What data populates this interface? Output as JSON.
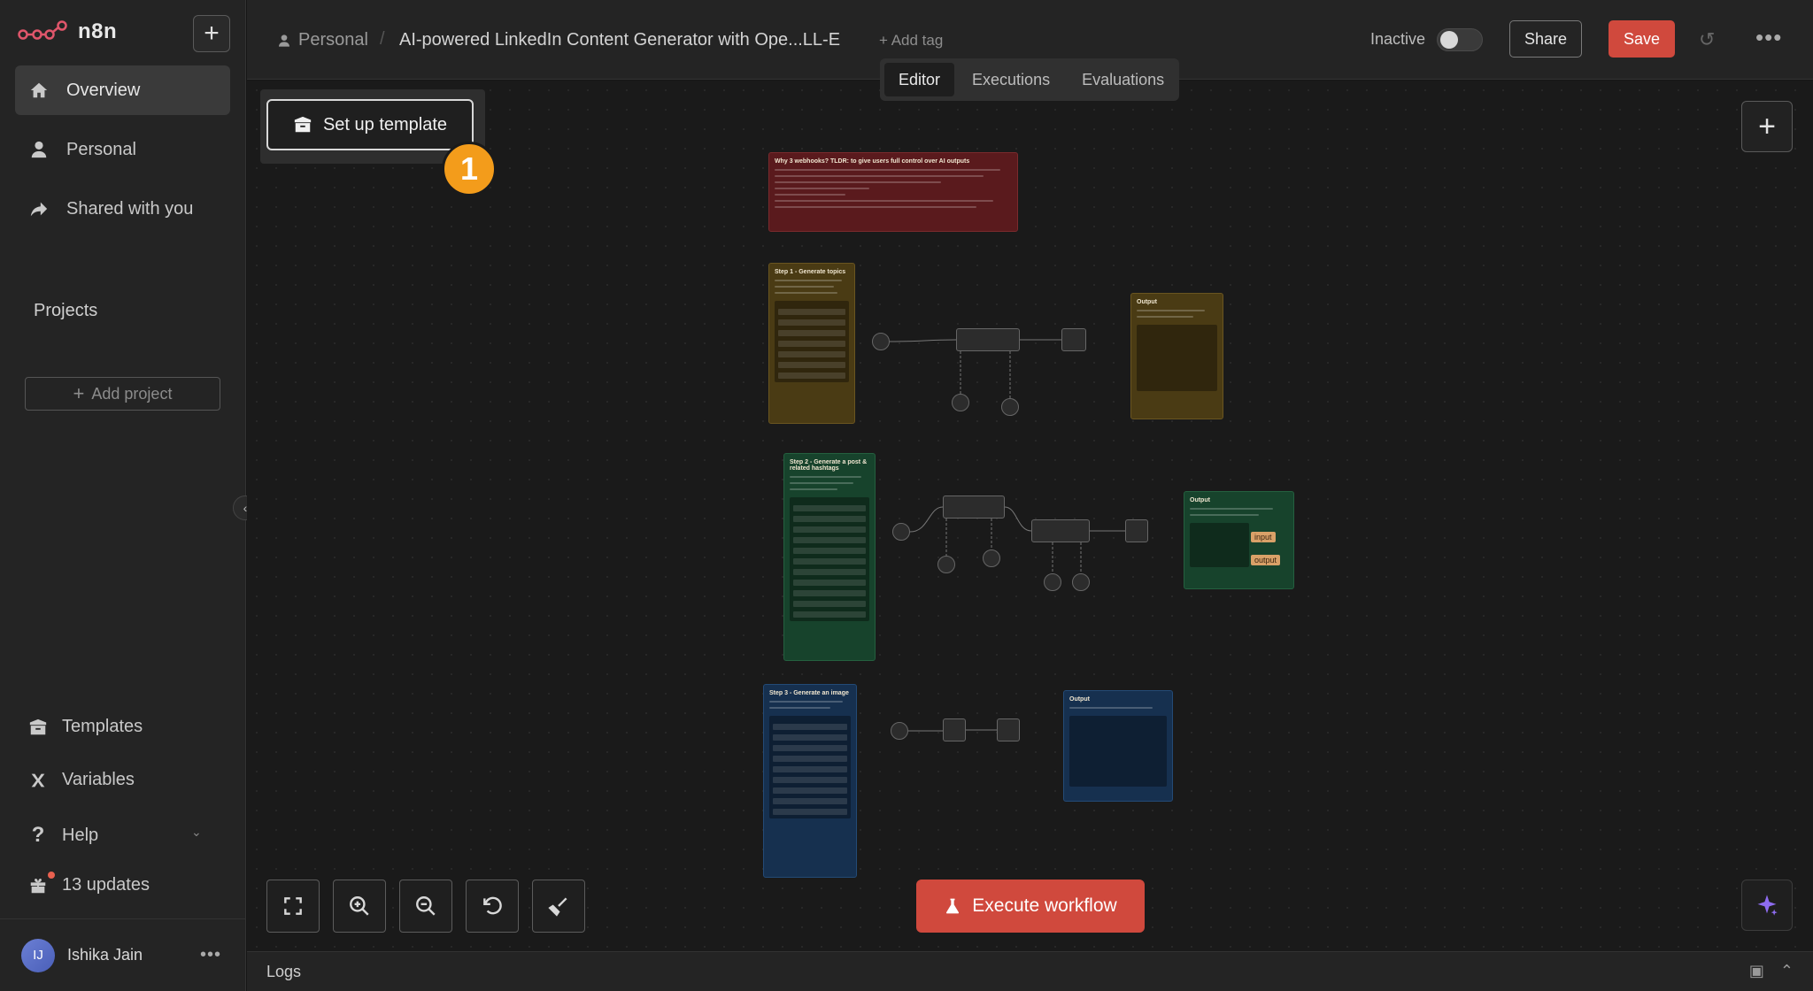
{
  "app": {
    "name": "n8n"
  },
  "sidebar": {
    "nav": [
      {
        "label": "Overview"
      },
      {
        "label": "Personal"
      },
      {
        "label": "Shared with you"
      }
    ],
    "projects_heading": "Projects",
    "add_project_label": "Add project",
    "bottom": [
      {
        "label": "Templates"
      },
      {
        "label": "Variables"
      },
      {
        "label": "Help"
      },
      {
        "label": "13 updates"
      }
    ],
    "user": {
      "initials": "IJ",
      "name": "Ishika Jain"
    }
  },
  "header": {
    "owner": "Personal",
    "workflow_title": "AI-powered LinkedIn Content Generator with Ope...LL-E",
    "add_tag": "+ Add tag",
    "status_label": "Inactive",
    "share_label": "Share",
    "save_label": "Save",
    "tabs": [
      {
        "label": "Editor",
        "active": true
      },
      {
        "label": "Executions",
        "active": false
      },
      {
        "label": "Evaluations",
        "active": false
      }
    ]
  },
  "canvas": {
    "setup_template_label": "Set up template",
    "step_badge": "1",
    "execute_label": "Execute workflow",
    "notes": {
      "intro": "Why 3 webhooks? TLDR: to give users full control over AI outputs",
      "step1": "Step 1 - Generate topics",
      "step1_output": "Output",
      "step2": "Step 2 - Generate a post & related hashtags",
      "step2_output": "Output",
      "step3": "Step 3 - Generate an image",
      "step3_output": "Output",
      "tag_input": "input",
      "tag_output": "output"
    }
  },
  "logs": {
    "label": "Logs"
  },
  "colors": {
    "accent_red": "#d0493d",
    "badge_orange": "#f39c1b",
    "note_red": "#5a1a1d",
    "note_yellow": "#4a3b14",
    "note_green": "#17432c",
    "note_blue": "#16304f"
  }
}
